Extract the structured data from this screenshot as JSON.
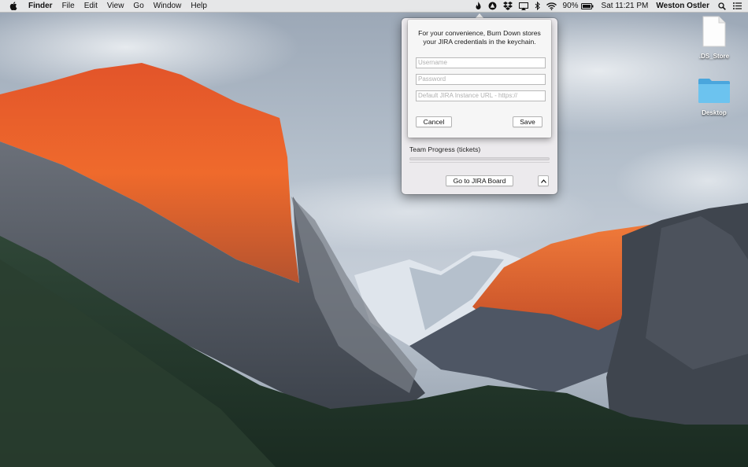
{
  "menubar": {
    "app_name": "Finder",
    "menus": [
      "File",
      "Edit",
      "View",
      "Go",
      "Window",
      "Help"
    ],
    "battery": "90%",
    "clock": "Sat 11:21 PM",
    "user": "Weston Ostler",
    "status_icons": [
      "burn-down-flame-icon",
      "app-triangle-icon",
      "dropbox-icon",
      "airplay-icon",
      "bluetooth-icon",
      "wifi-icon",
      "battery-icon",
      "spotlight-search-icon",
      "notification-center-icon"
    ]
  },
  "desktop": {
    "icons": [
      {
        "label": ".DS_Store",
        "kind": "document-icon"
      },
      {
        "label": "Desktop",
        "kind": "folder-icon"
      }
    ]
  },
  "popover": {
    "message": "For your convenience, Burn Down stores your JIRA credentials in the keychain.",
    "username_placeholder": "Username",
    "password_placeholder": "Password",
    "url_placeholder": "Default JIRA Instance URL - https://",
    "cancel_label": "Cancel",
    "save_label": "Save",
    "progress_label": "Team Progress (tickets)",
    "progress_value": 0,
    "board_button_label": "Go to JIRA Board",
    "collapse_icon": "chevron-up-icon"
  },
  "colors": {
    "progress_accent": "#3b82f6",
    "folder_blue": "#5bb7e8"
  }
}
